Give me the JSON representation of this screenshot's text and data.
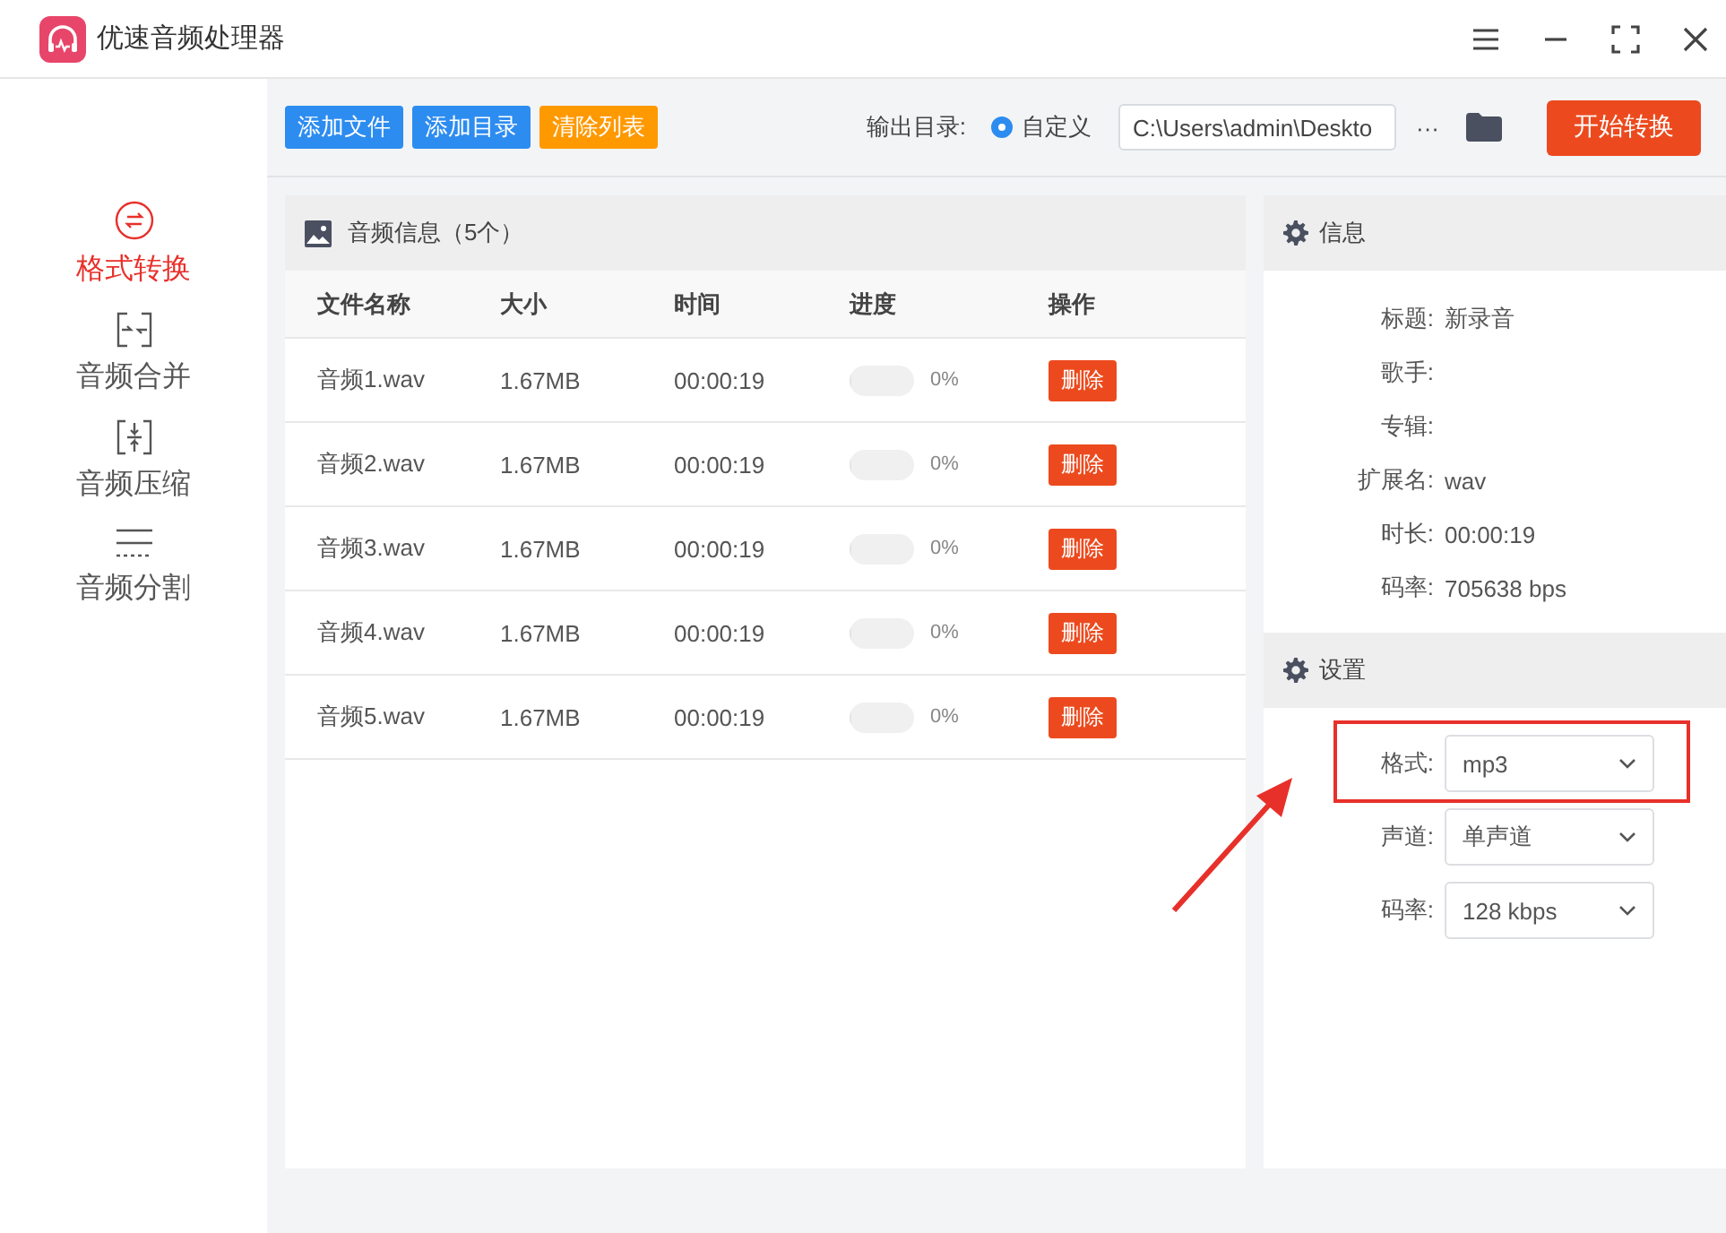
{
  "window": {
    "title": "优速音频处理器"
  },
  "sidebar": {
    "items": [
      {
        "label": "格式转换",
        "selected": true,
        "kind": "convert"
      },
      {
        "label": "音频合并",
        "selected": false,
        "kind": "merge"
      },
      {
        "label": "音频压缩",
        "selected": false,
        "kind": "compress"
      },
      {
        "label": "音频分割",
        "selected": false,
        "kind": "split"
      }
    ]
  },
  "toolbar": {
    "buttons": [
      {
        "label": "添加文件",
        "kind": "blue"
      },
      {
        "label": "添加目录",
        "kind": "blue"
      },
      {
        "label": "清除列表",
        "kind": "orange"
      }
    ],
    "output_label": "输出目录:",
    "radio": {
      "label": "自定义",
      "selected": true
    },
    "path": "C:\\Users\\admin\\Deskto",
    "more": "···",
    "start": "开始转换"
  },
  "files": {
    "title": "音频信息（5个）",
    "columns": [
      "文件名称",
      "大小",
      "时间",
      "进度",
      "操作"
    ],
    "rows": [
      {
        "name": "音频1.wav",
        "size": "1.67MB",
        "time": "00:00:19",
        "level": 0,
        "percent": "0%",
        "action": "删除"
      },
      {
        "name": "音频2.wav",
        "size": "1.67MB",
        "time": "00:00:19",
        "level": 0,
        "percent": "0%",
        "action": "删除"
      },
      {
        "name": "音频3.wav",
        "size": "1.67MB",
        "time": "00:00:19",
        "level": 0,
        "percent": "0%",
        "action": "删除"
      },
      {
        "name": "音频4.wav",
        "size": "1.67MB",
        "time": "00:00:19",
        "level": 0,
        "percent": "0%",
        "action": "删除"
      },
      {
        "name": "音频5.wav",
        "size": "1.67MB",
        "time": "00:00:19",
        "level": 0,
        "percent": "0%",
        "action": "删除"
      }
    ]
  },
  "info": {
    "title": "信息",
    "fields": [
      {
        "label": "标题:",
        "value": "新录音"
      },
      {
        "label": "歌手:"
      },
      {
        "label": "专辑:"
      },
      {
        "label": "扩展名:",
        "value": "wav"
      },
      {
        "label": "时长:",
        "value": "00:00:19"
      },
      {
        "label": "码率:",
        "value": "705638 bps"
      }
    ]
  },
  "settings": {
    "title": "设置",
    "fields": [
      {
        "label": "格式:",
        "value": "mp3",
        "highlighted": true
      },
      {
        "label": "声道:",
        "value": "单声道",
        "highlighted": false
      },
      {
        "label": "码率:",
        "value": "128 kbps",
        "highlighted": false
      }
    ]
  }
}
